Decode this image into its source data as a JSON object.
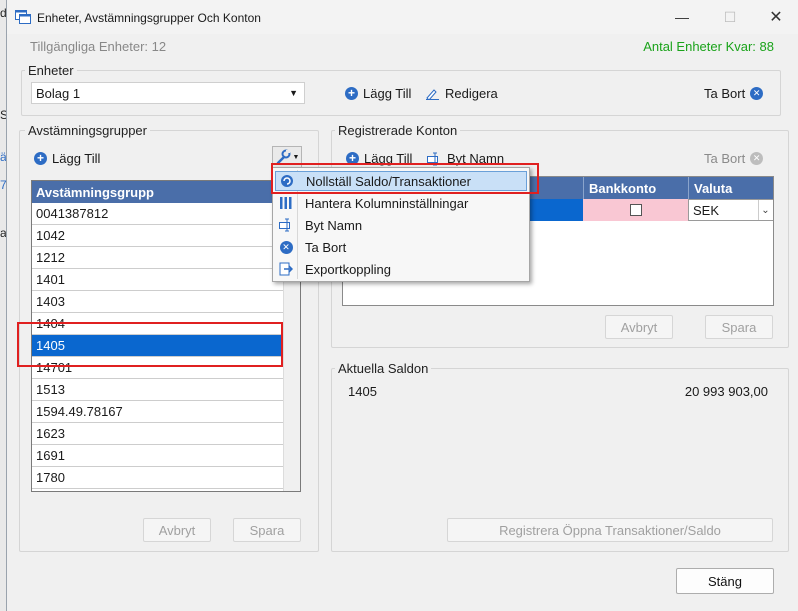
{
  "window": {
    "title": "Enheter, Avstämningsgrupper Och Konton",
    "available_units": "Tillgängliga Enheter: 12",
    "units_left": "Antal Enheter Kvar: 88",
    "colors": {
      "accent": "#4a6ea9",
      "selection": "#0a67cf",
      "green": "#1aa31a",
      "highlight_border": "#e02020"
    }
  },
  "enheter": {
    "label": "Enheter",
    "selected": "Bolag 1",
    "add_label": "Lägg Till",
    "edit_label": "Redigera",
    "delete_label": "Ta Bort"
  },
  "groups": {
    "label": "Avstämningsgrupper",
    "add_label": "Lägg Till",
    "column_header": "Avstämningsgrupp",
    "rows": [
      "0041387812",
      "1042",
      "1212",
      "1401",
      "1403",
      "1404",
      "1405",
      "14701",
      "1513",
      "1594.49.78167",
      "1623",
      "1691",
      "1780"
    ],
    "selected_row": "1405",
    "cancel_label": "Avbryt",
    "save_label": "Spara"
  },
  "menu": {
    "items": [
      {
        "label": "Nollställ Saldo/Transaktioner",
        "icon": "reset-icon"
      },
      {
        "label": "Hantera Kolumninställningar",
        "icon": "columns-icon"
      },
      {
        "label": "Byt Namn",
        "icon": "rename-icon"
      },
      {
        "label": "Ta Bort",
        "icon": "delete-icon"
      },
      {
        "label": "Exportkoppling",
        "icon": "export-icon"
      }
    ]
  },
  "accounts": {
    "label": "Registrerade Konton",
    "add_label": "Lägg Till",
    "rename_label": "Byt Namn",
    "delete_label": "Ta Bort",
    "headers": {
      "bank_account": "Bankkonto",
      "currency": "Valuta"
    },
    "row": {
      "currency": "SEK"
    },
    "cancel_label": "Avbryt",
    "save_label": "Spara"
  },
  "balances": {
    "label": "Aktuella Saldon",
    "group": "1405",
    "amount": "20 993 903,00",
    "register_label": "Registrera Öppna Transaktioner/Saldo"
  },
  "footer": {
    "close_label": "Stäng"
  },
  "background_app": {
    "fragments": [
      "d",
      "Se",
      "ä",
      "7",
      "a"
    ]
  }
}
